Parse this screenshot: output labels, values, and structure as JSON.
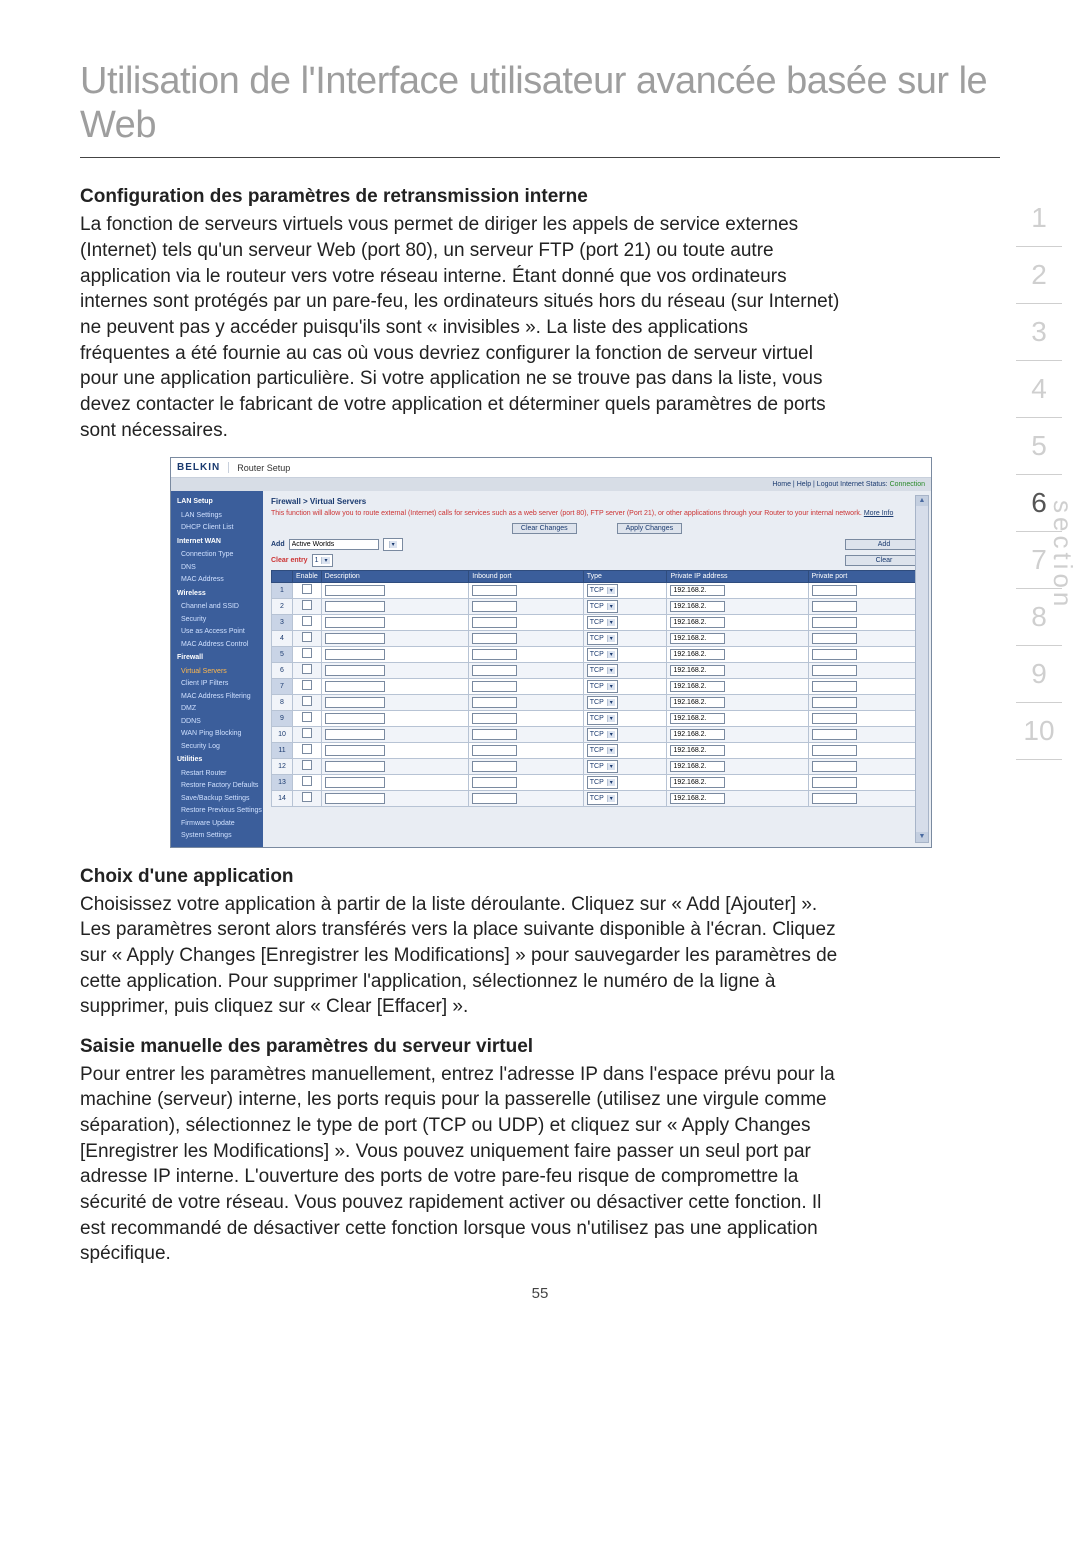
{
  "page": {
    "title": "Utilisation de l'Interface utilisateur avancée basée sur le Web",
    "pageNumber": "55"
  },
  "sections": {
    "s1": {
      "heading": "Configuration des paramètres de retransmission interne",
      "body": "La fonction de serveurs virtuels vous permet de diriger les appels de service externes (Internet) tels qu'un serveur Web (port 80), un serveur FTP (port 21) ou toute autre application via le routeur vers votre réseau interne. Étant donné que vos ordinateurs internes sont protégés par un pare-feu, les ordinateurs situés hors du réseau (sur Internet) ne peuvent pas y accéder puisqu'ils sont « invisibles ». La liste des applications fréquentes a été fournie au cas où vous devriez configurer la fonction de serveur virtuel pour une application particulière. Si votre application ne se trouve pas dans la liste, vous devez contacter le fabricant de votre application et déterminer quels paramètres de ports sont nécessaires."
    },
    "s2": {
      "heading": "Choix d'une application",
      "body": "Choisissez votre application à partir de la liste déroulante. Cliquez sur « Add [Ajouter] ». Les paramètres seront alors transférés vers la place suivante disponible à l'écran. Cliquez sur « Apply Changes [Enregistrer les Modifications] » pour sauvegarder les paramètres de cette application. Pour supprimer l'application, sélectionnez le numéro de la ligne à supprimer, puis cliquez sur « Clear [Effacer] »."
    },
    "s3": {
      "heading": "Saisie manuelle des paramètres du serveur virtuel",
      "body": "Pour entrer les paramètres manuellement, entrez l'adresse IP dans l'espace prévu pour la machine (serveur) interne, les ports requis pour la passerelle (utilisez une virgule comme séparation), sélectionnez le type de port (TCP ou UDP) et cliquez sur « Apply Changes [Enregistrer les Modifications] ». Vous pouvez uniquement faire passer un seul port par adresse IP interne. L'ouverture des ports de votre pare-feu risque de compromettre la sécurité de votre réseau. Vous pouvez rapidement activer ou désactiver cette fonction. Il est recommandé de désactiver cette fonction lorsque vous n'utilisez pas une application spécifique."
    }
  },
  "index": {
    "items": [
      "1",
      "2",
      "3",
      "4",
      "5",
      "6",
      "7",
      "8",
      "9",
      "10"
    ],
    "active": "6",
    "label": "section"
  },
  "router": {
    "logo": "BELKIN",
    "setupLabel": "Router Setup",
    "topbar": {
      "links": "Home | Help | Logout   Internet Status:",
      "status": "Connection"
    },
    "breadcrumb": "Firewall > Virtual Servers",
    "desc": "This function will allow you to route external (Internet) calls for services such as a web server (port 80), FTP server (Port 21), or other applications through your Router to your internal network.",
    "descMore": "More Info",
    "buttons": {
      "clearChanges": "Clear Changes",
      "applyChanges": "Apply Changes",
      "add": "Add",
      "clear": "Clear"
    },
    "addRow": {
      "label": "Add",
      "value": "Active Worlds"
    },
    "clearRow": {
      "label": "Clear entry",
      "value": "1"
    },
    "nav": {
      "groups": [
        {
          "sec": "LAN Setup",
          "items": [
            "LAN Settings",
            "DHCP Client List"
          ]
        },
        {
          "sec": "Internet WAN",
          "items": [
            "Connection Type",
            "DNS",
            "MAC Address"
          ]
        },
        {
          "sec": "Wireless",
          "items": [
            "Channel and SSID",
            "Security",
            "Use as Access Point",
            "MAC Address Control"
          ]
        },
        {
          "sec": "Firewall",
          "items": [
            "Virtual Servers",
            "Client IP Filters",
            "MAC Address Filtering",
            "DMZ",
            "DDNS",
            "WAN Ping Blocking",
            "Security Log"
          ],
          "hi": "Virtual Servers"
        },
        {
          "sec": "Utilities",
          "items": [
            "Restart Router",
            "Restore Factory Defaults",
            "Save/Backup Settings",
            "Restore Previous Settings",
            "Firmware Update",
            "System Settings"
          ]
        }
      ]
    },
    "table": {
      "headers": [
        "",
        "Enable",
        "Description",
        "Inbound port",
        "Type",
        "Private IP address",
        "Private port"
      ],
      "rows": [
        {
          "n": "1",
          "type": "TCP",
          "ip": "192.168.2."
        },
        {
          "n": "2",
          "type": "TCP",
          "ip": "192.168.2."
        },
        {
          "n": "3",
          "type": "TCP",
          "ip": "192.168.2."
        },
        {
          "n": "4",
          "type": "TCP",
          "ip": "192.168.2."
        },
        {
          "n": "5",
          "type": "TCP",
          "ip": "192.168.2."
        },
        {
          "n": "6",
          "type": "TCP",
          "ip": "192.168.2."
        },
        {
          "n": "7",
          "type": "TCP",
          "ip": "192.168.2."
        },
        {
          "n": "8",
          "type": "TCP",
          "ip": "192.168.2."
        },
        {
          "n": "9",
          "type": "TCP",
          "ip": "192.168.2."
        },
        {
          "n": "10",
          "type": "TCP",
          "ip": "192.168.2."
        },
        {
          "n": "11",
          "type": "TCP",
          "ip": "192.168.2."
        },
        {
          "n": "12",
          "type": "TCP",
          "ip": "192.168.2."
        },
        {
          "n": "13",
          "type": "TCP",
          "ip": "192.168.2."
        },
        {
          "n": "14",
          "type": "TCP",
          "ip": "192.168.2."
        }
      ]
    }
  }
}
